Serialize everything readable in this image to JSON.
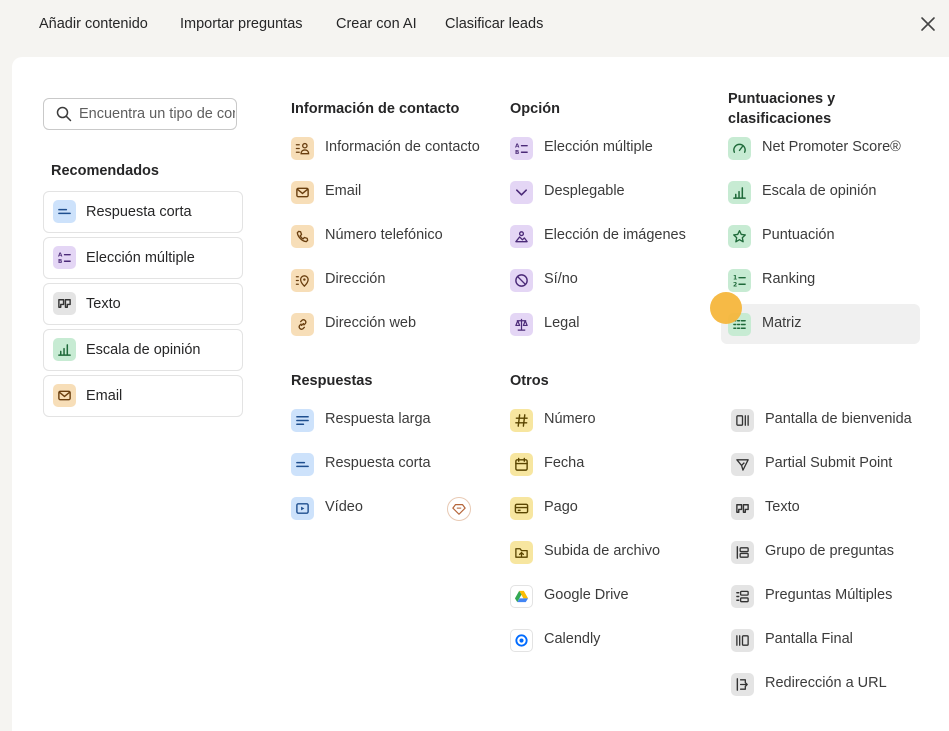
{
  "tabs": [
    {
      "label": "Añadir contenido"
    },
    {
      "label": "Importar preguntas"
    },
    {
      "label": "Crear con AI"
    },
    {
      "label": "Clasificar leads"
    }
  ],
  "search": {
    "placeholder": "Encuentra un tipo de contenido",
    "value": ""
  },
  "recommended": {
    "title": "Recomendados",
    "items": [
      {
        "label": "Respuesta corta",
        "icon": "short-text-icon",
        "color": "#cde2fb"
      },
      {
        "label": "Elección múltiple",
        "icon": "multiple-choice-icon",
        "color": "#e4d6f5"
      },
      {
        "label": "Texto",
        "icon": "quote-icon",
        "color": "#e4e4e4"
      },
      {
        "label": "Escala de opinión",
        "icon": "bar-chart-icon",
        "color": "#c7ebd3"
      },
      {
        "label": "Email",
        "icon": "mail-icon",
        "color": "#f7deb8"
      }
    ]
  },
  "contact": {
    "title": "Información de contacto",
    "items": [
      {
        "label": "Información de contacto",
        "icon": "contact-card-icon"
      },
      {
        "label": "Email",
        "icon": "mail-icon"
      },
      {
        "label": "Número telefónico",
        "icon": "phone-icon"
      },
      {
        "label": "Dirección",
        "icon": "location-pin-icon"
      },
      {
        "label": "Dirección web",
        "icon": "link-icon"
      }
    ]
  },
  "answers": {
    "title": "Respuestas",
    "items": [
      {
        "label": "Respuesta larga",
        "icon": "long-text-icon"
      },
      {
        "label": "Respuesta corta",
        "icon": "short-text-icon"
      },
      {
        "label": "Vídeo",
        "icon": "video-play-icon",
        "premium": "diamond-icon"
      }
    ]
  },
  "choice": {
    "title": "Opción",
    "items": [
      {
        "label": "Elección múltiple",
        "icon": "multiple-choice-icon"
      },
      {
        "label": "Desplegable",
        "icon": "chevron-down-icon"
      },
      {
        "label": "Elección de imágenes",
        "icon": "image-icon"
      },
      {
        "label": "Sí/no",
        "icon": "yes-no-icon"
      },
      {
        "label": "Legal",
        "icon": "scales-icon"
      }
    ]
  },
  "others": {
    "title": "Otros",
    "items": [
      {
        "label": "Número",
        "icon": "hash-icon"
      },
      {
        "label": "Fecha",
        "icon": "calendar-icon"
      },
      {
        "label": "Pago",
        "icon": "credit-card-icon"
      },
      {
        "label": "Subida de archivo",
        "icon": "upload-icon"
      },
      {
        "label": "Google Drive",
        "icon": "google-drive-icon"
      },
      {
        "label": "Calendly",
        "icon": "calendly-icon"
      }
    ]
  },
  "ratings": {
    "title": "Puntuaciones y clasificaciones",
    "items": [
      {
        "label": "Net Promoter Score®",
        "icon": "gauge-icon"
      },
      {
        "label": "Escala de opinión",
        "icon": "bar-chart-icon"
      },
      {
        "label": "Puntuación",
        "icon": "star-icon"
      },
      {
        "label": "Ranking",
        "icon": "ranking-icon"
      },
      {
        "label": "Matriz",
        "icon": "matrix-icon",
        "hovered": true
      }
    ]
  },
  "structure": {
    "items": [
      {
        "label": "Pantalla de bienvenida",
        "icon": "welcome-screen-icon"
      },
      {
        "label": "Partial Submit Point",
        "icon": "send-icon"
      },
      {
        "label": "Texto",
        "icon": "quote-icon"
      },
      {
        "label": "Grupo de preguntas",
        "icon": "question-group-icon"
      },
      {
        "label": "Preguntas Múltiples",
        "icon": "multi-question-icon"
      },
      {
        "label": "Pantalla Final",
        "icon": "end-screen-icon"
      },
      {
        "label": "Redirección a URL",
        "icon": "redirect-icon"
      }
    ]
  }
}
